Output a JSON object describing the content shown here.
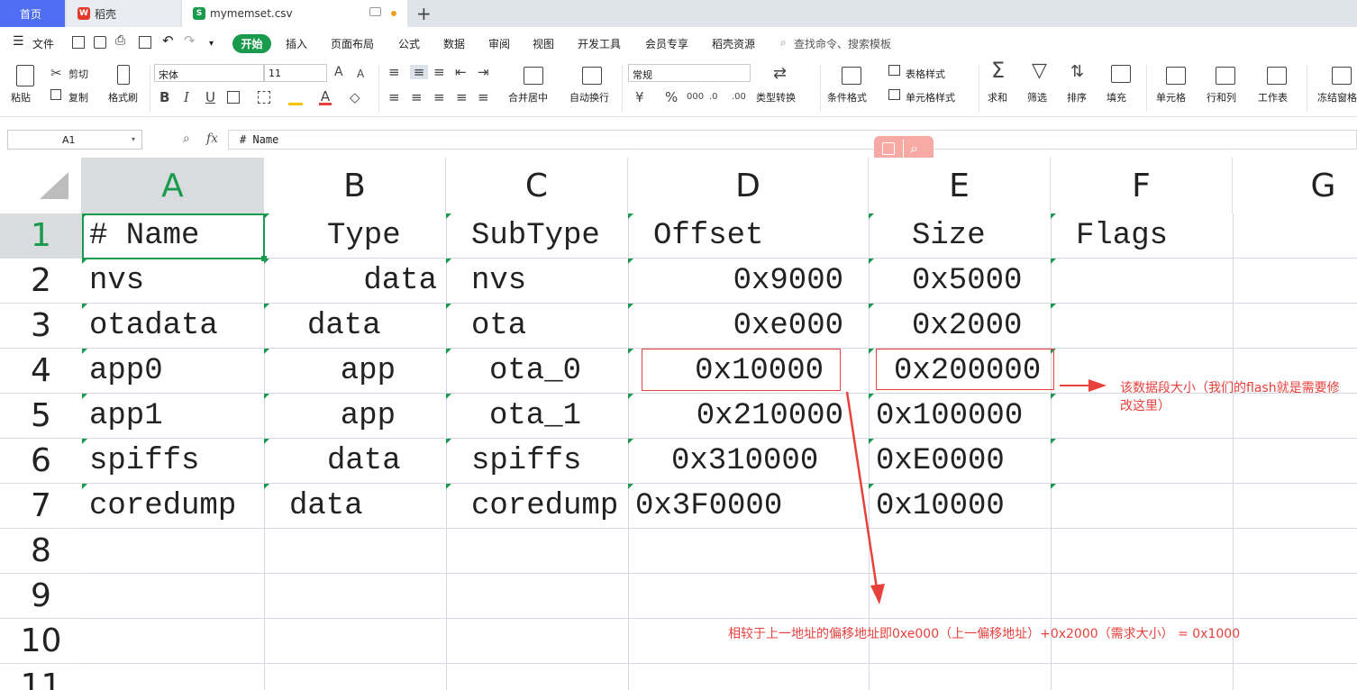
{
  "tabs": {
    "home": "首页",
    "doc": "稻壳",
    "file": "mymemset.csv",
    "doc_icon_glyph": "W",
    "file_icon_glyph": "S"
  },
  "menu": {
    "file": "文件",
    "start": "开始",
    "items": [
      "插入",
      "页面布局",
      "公式",
      "数据",
      "审阅",
      "视图",
      "开发工具",
      "会员专享",
      "稻壳资源"
    ],
    "search": "查找命令、搜索模板"
  },
  "ribbon": {
    "paste": "粘贴",
    "cut": "剪切",
    "copy": "复制",
    "format_painter": "格式刷",
    "font_name": "宋体",
    "font_size": "11",
    "bold": "B",
    "italic": "I",
    "underline": "U",
    "merge_center": "合并居中",
    "wrap": "自动换行",
    "number_format": "常规",
    "currency": "¥",
    "percent": "%",
    "type_convert": "类型转换",
    "cond_format": "条件格式",
    "table_style": "表格样式",
    "cell_style": "单元格样式",
    "sum": "求和",
    "filter": "筛选",
    "sort": "排序",
    "fill": "填充",
    "cell": "单元格",
    "rowcol": "行和列",
    "sheet": "工作表",
    "freeze": "冻结窗格"
  },
  "formula_bar": {
    "name_box": "A1",
    "fx": "fx",
    "content": "# Name"
  },
  "sheet": {
    "columns": [
      "A",
      "B",
      "C",
      "D",
      "E",
      "F",
      "G"
    ],
    "rows": [
      "1",
      "2",
      "3",
      "4",
      "5",
      "6",
      "7",
      "8",
      "9",
      "10",
      "11"
    ],
    "cells": [
      [
        "# Name",
        "Type",
        "SubType",
        "Offset",
        "Size",
        "Flags"
      ],
      [
        "nvs",
        "data",
        "nvs",
        "0x9000",
        "0x5000",
        ""
      ],
      [
        "otadata",
        "data",
        "ota",
        "0xe000",
        "0x2000",
        ""
      ],
      [
        "app0",
        "app",
        "ota_0",
        "0x10000",
        "0x200000",
        ""
      ],
      [
        "app1",
        "app",
        "ota_1",
        "0x210000",
        "0x100000",
        ""
      ],
      [
        "spiffs",
        "data",
        "spiffs",
        "0x310000",
        "0xE0000",
        ""
      ],
      [
        "coredump",
        "data",
        "coredump",
        "0x3F0000",
        "0x10000",
        ""
      ]
    ]
  },
  "annotations": {
    "size_note": "该数据段大小（我们的flash就是需要修改这里）",
    "offset_note": "相较于上一地址的偏移地址即0xe000（上一偏移地址）+0x2000（需求大小） = 0x1000"
  },
  "colors": {
    "accent_green": "#1a9a4c",
    "annotation_red": "#e8413c",
    "home_tab_blue": "#4f6ef2"
  }
}
